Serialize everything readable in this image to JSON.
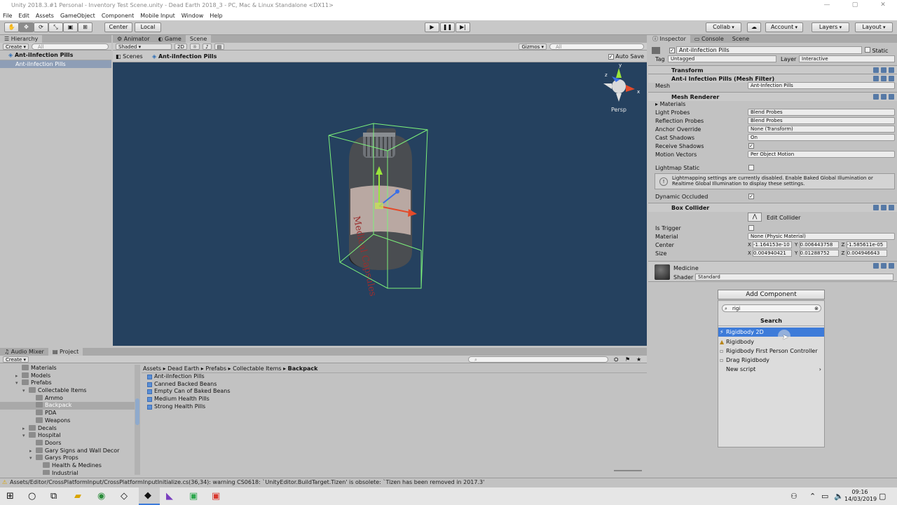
{
  "window": {
    "title": "Unity 2018.3.#1 Personal - Inventory Test Scene.unity - Dead Earth 2018_3 - PC, Mac & Linux Standalone <DX11>"
  },
  "menu": [
    "File",
    "Edit",
    "Assets",
    "GameObject",
    "Component",
    "Mobile Input",
    "Window",
    "Help"
  ],
  "toolbar": {
    "pivot": "Center",
    "space": "Local",
    "collab": "Collab",
    "account": "Account",
    "layers": "Layers",
    "layout": "Layout"
  },
  "hierarchy": {
    "tab": "Hierarchy",
    "create": "Create",
    "search_placeholder": "All",
    "scene_name": "Ant-iInfection Pills",
    "item": "Ant-iInfection Pills"
  },
  "scene_panel": {
    "tabs": [
      "Animator",
      "Game",
      "Scene"
    ],
    "shading": "Shaded",
    "mode_2d": "2D",
    "gizmos": "Gizmos",
    "search_placeholder": "All",
    "breadcrumb_root": "Scenes",
    "breadcrumb_item": "Ant-iInfection Pills",
    "auto_save": "Auto Save",
    "persp": "Persp",
    "bottle_text": "Medical Capsules"
  },
  "project": {
    "tabs": [
      "Audio Mixer",
      "Project"
    ],
    "create": "Create",
    "tree": [
      {
        "label": "Materials",
        "indent": 0,
        "arrow": ""
      },
      {
        "label": "Models",
        "indent": 0,
        "arrow": "▸"
      },
      {
        "label": "Prefabs",
        "indent": 0,
        "arrow": "▾"
      },
      {
        "label": "Collectable Items",
        "indent": 1,
        "arrow": "▾"
      },
      {
        "label": "Ammo",
        "indent": 2,
        "arrow": ""
      },
      {
        "label": "Backpack",
        "indent": 2,
        "arrow": "",
        "selected": true
      },
      {
        "label": "PDA",
        "indent": 2,
        "arrow": ""
      },
      {
        "label": "Weapons",
        "indent": 2,
        "arrow": ""
      },
      {
        "label": "Decals",
        "indent": 1,
        "arrow": "▸"
      },
      {
        "label": "Hospital",
        "indent": 1,
        "arrow": "▾"
      },
      {
        "label": "Doors",
        "indent": 2,
        "arrow": ""
      },
      {
        "label": "Gary Signs and Wall Decor",
        "indent": 2,
        "arrow": "▸"
      },
      {
        "label": "Garys Props",
        "indent": 2,
        "arrow": "▾"
      },
      {
        "label": "Health & Medines",
        "indent": 3,
        "arrow": ""
      },
      {
        "label": "Industrial",
        "indent": 3,
        "arrow": ""
      }
    ],
    "path": [
      "Assets",
      "Dead Earth",
      "Prefabs",
      "Collectable Items",
      "Backpack"
    ],
    "assets": [
      "Ant-iInfection Pills",
      "Canned Backed Beans",
      "Empty Can of Baked Beans",
      "Medium Health Pills",
      "Strong Health Pills"
    ]
  },
  "status": "Assets/Editor/CrossPlatformInput/CrossPlatformInputInitialize.cs(36,34): warning CS0618: `UnityEditor.BuildTarget.Tizen' is obsolete: `Tizen has been removed in 2017.3'",
  "inspector": {
    "tabs": [
      "Inspector",
      "Console",
      "Scene"
    ],
    "object_name": "Ant-iInfection Pills",
    "static_label": "Static",
    "tag_label": "Tag",
    "tag_value": "Untagged",
    "layer_label": "Layer",
    "layer_value": "Interactive",
    "transform": "Transform",
    "mesh_filter": "Ant-i Infection Pills (Mesh Filter)",
    "mesh_label": "Mesh",
    "mesh_value": "Ant-Infection Pills",
    "mesh_renderer": "Mesh Renderer",
    "materials_label": "Materials",
    "light_probes_label": "Light Probes",
    "light_probes_value": "Blend Probes",
    "reflection_probes_label": "Reflection Probes",
    "reflection_probes_value": "Blend Probes",
    "anchor_override_label": "Anchor Override",
    "anchor_override_value": "None (Transform)",
    "cast_shadows_label": "Cast Shadows",
    "cast_shadows_value": "On",
    "receive_shadows_label": "Receive Shadows",
    "motion_vectors_label": "Motion Vectors",
    "motion_vectors_value": "Per Object Motion",
    "lightmap_static_label": "Lightmap Static",
    "lightmap_info": "Lightmapping settings are currently disabled. Enable Baked Global Illumination or Realtime Global Illumination to display these settings.",
    "dynamic_occluded_label": "Dynamic Occluded",
    "box_collider": "Box Collider",
    "edit_collider": "Edit Collider",
    "is_trigger_label": "Is Trigger",
    "material_label": "Material",
    "material_value": "None (Physic Material)",
    "center_label": "Center",
    "center_x": "-1.164153e-10",
    "center_y": "0.006443758",
    "center_z": "-1.585611e-05",
    "size_label": "Size",
    "size_x": "0.004940421",
    "size_y": "0.01288752",
    "size_z": "0.004946643",
    "material_name": "Medicine",
    "shader_label": "Shader",
    "shader_value": "Standard",
    "add_component": "Add Component",
    "search_value": "rigi",
    "search_header": "Search",
    "results": [
      "Rigidbody 2D",
      "Rigidbody",
      "Rigidbody First Person Controller",
      "Drag Rigidbody",
      "New script"
    ]
  },
  "taskbar": {
    "time": "09:16",
    "date": "14/03/2019"
  }
}
